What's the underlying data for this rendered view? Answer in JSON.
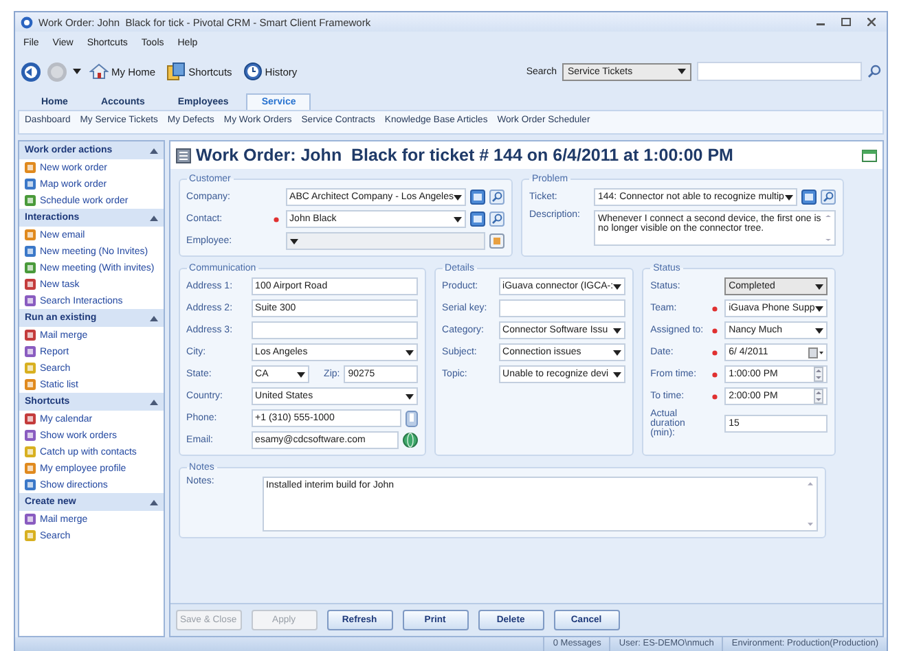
{
  "window": {
    "title": "Work Order: John  Black for tick - Pivotal CRM - Smart Client Framework"
  },
  "menu": [
    "File",
    "View",
    "Shortcuts",
    "Tools",
    "Help"
  ],
  "toolbar": {
    "items": [
      {
        "kind": "home",
        "label": "My Home"
      },
      {
        "kind": "shortcuts",
        "label": "Shortcuts"
      },
      {
        "kind": "history",
        "label": "History"
      }
    ],
    "search_label": "Search",
    "search_scope": "Service Tickets"
  },
  "tabs": [
    {
      "label": "Home",
      "selected": false
    },
    {
      "label": "Accounts",
      "selected": false
    },
    {
      "label": "Employees",
      "selected": false
    },
    {
      "label": "Service",
      "selected": true
    }
  ],
  "subnav": [
    "Dashboard",
    "My Service Tickets",
    "My Defects",
    "My Work Orders",
    "Service Contracts",
    "Knowledge Base Articles",
    "Work Order Scheduler"
  ],
  "sidebar": [
    {
      "title": "Work order actions",
      "items": [
        "New work order",
        "Map work order",
        "Schedule work order"
      ]
    },
    {
      "title": "Interactions",
      "items": [
        "New email",
        "New meeting (No Invites)",
        "New meeting (With invites)",
        "New task",
        "Search Interactions"
      ]
    },
    {
      "title": "Run an existing",
      "items": [
        "Mail merge",
        "Report",
        "Search",
        "Static list"
      ]
    },
    {
      "title": "Shortcuts",
      "items": [
        "My calendar",
        "Show work orders",
        "Catch up with contacts",
        "My employee profile",
        "Show directions"
      ]
    },
    {
      "title": "Create new",
      "items": [
        "Mail merge",
        "Search"
      ]
    }
  ],
  "form": {
    "title": "Work Order: John  Black for ticket # 144 on 6/4/2011 at 1:00:00 PM",
    "rows": [
      {
        "groups": [
          {
            "title": "Customer",
            "fields": [
              {
                "label": "Company:",
                "kind": "dropdown",
                "value": "ABC Architect Company - Los Angeles",
                "actions": [
                  {
                    "kind": "open"
                  },
                  {
                    "kind": "lookup"
                  }
                ]
              },
              {
                "label": "Contact:",
                "kind": "dropdown",
                "value": "John  Black",
                "required": true,
                "actions": [
                  {
                    "kind": "open"
                  },
                  {
                    "kind": "lookup"
                  }
                ]
              },
              {
                "label": "Employee:",
                "kind": "dropdown",
                "disabled": true,
                "actions": [
                  {
                    "kind": "card"
                  }
                ]
              }
            ]
          },
          {
            "title": "Problem",
            "fields": [
              {
                "label": "Ticket:",
                "kind": "dropdown",
                "value": "144: Connector not able to recognize multip",
                "actions": [
                  {
                    "kind": "open"
                  },
                  {
                    "kind": "lookup"
                  }
                ]
              },
              {
                "label": "Description:",
                "kind": "textarea",
                "value": "Whenever I connect a second device, the first one is no longer visible on the connector tree."
              }
            ]
          }
        ]
      },
      {
        "groups": [
          {
            "title": "Communication",
            "fields": [
              {
                "label": "Address 1:",
                "kind": "text",
                "value": "100 Airport Road"
              },
              {
                "label": "Address 2:",
                "kind": "text",
                "value": "Suite 300"
              },
              {
                "label": "Address 3:",
                "kind": "text"
              },
              {
                "label": "City:",
                "kind": "dropdown",
                "value": "Los Angeles"
              },
              {
                "label": "State:",
                "kind": "dropdown",
                "value": "CA",
                "pair": {
                  "label": "Zip:",
                  "value": "90275"
                }
              },
              {
                "label": "Country:",
                "kind": "dropdown",
                "value": "United States"
              },
              {
                "label": "Phone:",
                "kind": "text",
                "value": "+1 (310) 555-1000",
                "actions": [
                  {
                    "kind": "phone"
                  }
                ]
              },
              {
                "label": "Email:",
                "kind": "text",
                "value": "esamy@cdcsoftware.com",
                "actions": [
                  {
                    "kind": "web"
                  }
                ]
              }
            ]
          },
          {
            "title": "Details",
            "fields": [
              {
                "label": "Product:",
                "kind": "dropdown",
                "value": "iGuava connector (IGCA-:"
              },
              {
                "label": "Serial key:",
                "kind": "text"
              },
              {
                "label": "Category:",
                "kind": "dropdown",
                "value": "Connector Software Issu"
              },
              {
                "label": "Subject:",
                "kind": "dropdown",
                "value": "Connection issues"
              },
              {
                "label": "Topic:",
                "kind": "dropdown",
                "value": "Unable to recognize devi"
              }
            ]
          },
          {
            "title": "Status",
            "fields": [
              {
                "label": "Status:",
                "kind": "select",
                "value": "Completed"
              },
              {
                "label": "Team:",
                "kind": "dropdown",
                "value": "iGuava Phone Supp",
                "required": true
              },
              {
                "label": "Assigned to:",
                "kind": "dropdown",
                "value": "Nancy Much",
                "required": true
              },
              {
                "label": "Date:",
                "kind": "date",
                "value": "6/ 4/2011",
                "required": true
              },
              {
                "label": "From time:",
                "kind": "time",
                "value": "1:00:00 PM",
                "required": true
              },
              {
                "label": "To time:",
                "kind": "time",
                "value": "2:00:00 PM",
                "required": true
              },
              {
                "label": "Actual duration (min):",
                "kind": "text",
                "value": "15"
              }
            ]
          }
        ]
      },
      {
        "groups": [
          {
            "title": "Notes",
            "fields": [
              {
                "label": "Notes:",
                "kind": "textarea",
                "value": "Installed interim build for John"
              }
            ]
          }
        ]
      }
    ]
  },
  "buttons": [
    {
      "label": "Save & Close",
      "disabled": true
    },
    {
      "label": "Apply",
      "disabled": true
    },
    {
      "label": "Refresh",
      "disabled": false
    },
    {
      "label": "Print",
      "disabled": false
    },
    {
      "label": "Delete",
      "disabled": false
    },
    {
      "label": "Cancel",
      "disabled": false
    }
  ],
  "status_bar": [
    "0 Messages",
    "User: ES-DEMO\\nmuch",
    "Environment: Production(Production)"
  ]
}
